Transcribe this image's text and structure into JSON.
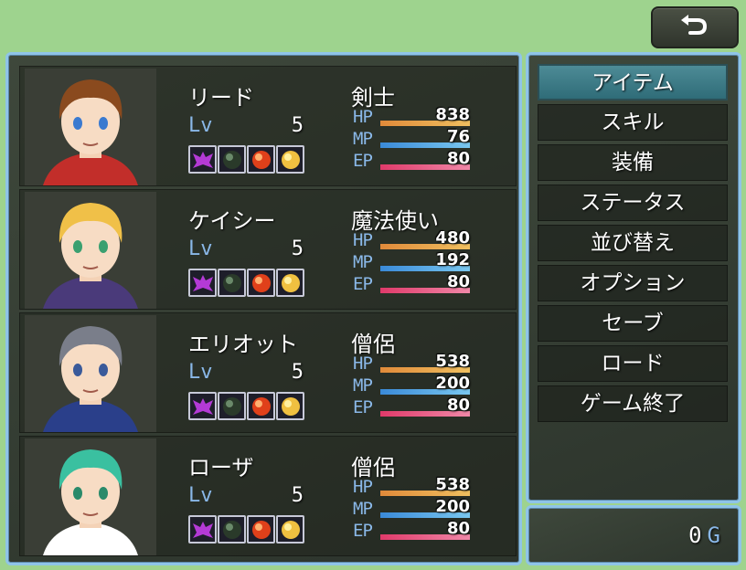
{
  "back_button": {
    "icon": "return-arrow-icon"
  },
  "actors": [
    {
      "name": "リード",
      "class": "剣士",
      "lv_label": "Lv",
      "level": "5",
      "hp_label": "HP",
      "hp": "838",
      "hp_ratio": 1,
      "mp_label": "MP",
      "mp": "76",
      "mp_ratio": 1,
      "ep_label": "EP",
      "ep": "80",
      "ep_ratio": 1,
      "hair": "#8a4a1e",
      "eyes": "#3a7ad0",
      "outfit": "#c22e2a"
    },
    {
      "name": "ケイシー",
      "class": "魔法使い",
      "lv_label": "Lv",
      "level": "5",
      "hp_label": "HP",
      "hp": "480",
      "hp_ratio": 1,
      "mp_label": "MP",
      "mp": "192",
      "mp_ratio": 1,
      "ep_label": "EP",
      "ep": "80",
      "ep_ratio": 1,
      "hair": "#f0c048",
      "eyes": "#3aa070",
      "outfit": "#4a3a7a"
    },
    {
      "name": "エリオット",
      "class": "僧侶",
      "lv_label": "Lv",
      "level": "5",
      "hp_label": "HP",
      "hp": "538",
      "hp_ratio": 1,
      "mp_label": "MP",
      "mp": "200",
      "mp_ratio": 1,
      "ep_label": "EP",
      "ep": "80",
      "ep_ratio": 1,
      "hair": "#7a7e8a",
      "eyes": "#3a5a9a",
      "outfit": "#2a3f8a"
    },
    {
      "name": "ローザ",
      "class": "僧侶",
      "lv_label": "Lv",
      "level": "5",
      "hp_label": "HP",
      "hp": "538",
      "hp_ratio": 1,
      "mp_label": "MP",
      "mp": "200",
      "mp_ratio": 1,
      "ep_label": "EP",
      "ep": "80",
      "ep_ratio": 1,
      "hair": "#3ac0a0",
      "eyes": "#2a8a6a",
      "outfit": "#ffffff"
    }
  ],
  "state_icons": [
    "demon-icon",
    "dark-orb-icon",
    "fire-orb-icon",
    "light-orb-icon"
  ],
  "commands": [
    {
      "label": "アイテム",
      "selected": true
    },
    {
      "label": "スキル"
    },
    {
      "label": "装備"
    },
    {
      "label": "ステータス"
    },
    {
      "label": "並び替え"
    },
    {
      "label": "オプション"
    },
    {
      "label": "セーブ"
    },
    {
      "label": "ロード"
    },
    {
      "label": "ゲーム終了"
    }
  ],
  "gold": {
    "amount": "0",
    "unit": "G"
  },
  "colors": {
    "hp_gauge": [
      "#e08a3a",
      "#f0c060"
    ],
    "mp_gauge": [
      "#3a8ad8",
      "#7ac8f0"
    ],
    "ep_gauge": [
      "#e03a6a",
      "#f088a8"
    ],
    "system_blue": "#8ab8e8",
    "selected_command": "#3f7d88"
  }
}
